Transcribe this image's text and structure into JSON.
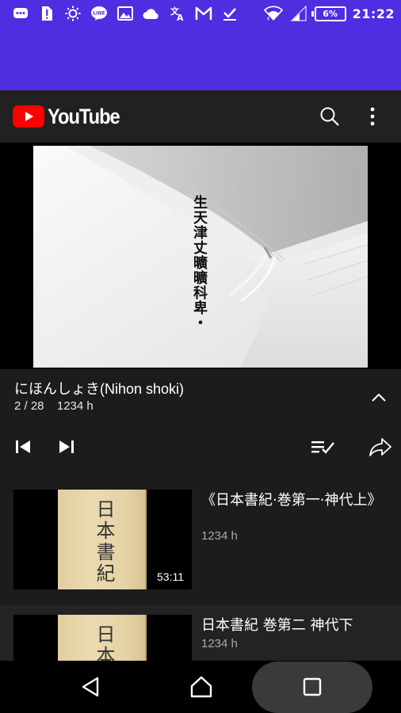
{
  "status_bar": {
    "icons": [
      "chat-icon",
      "sim-alert-icon",
      "brightness-icon",
      "line-app-icon",
      "image-icon",
      "cloud-icon",
      "translate-icon",
      "gmail-icon",
      "task-done-icon"
    ],
    "battery_percent": "6%",
    "time": "21:22"
  },
  "header": {
    "logo_text": "YouTube",
    "icons": [
      "search-icon",
      "more-vert-icon"
    ]
  },
  "player": {
    "overlay_text": "生天津丈曠曠科卑・"
  },
  "now_playing": {
    "title": "にほんしょき(Nihon shoki)",
    "position": "2 / 28",
    "views": "1234 h"
  },
  "controls": [
    "skip-previous-icon",
    "skip-next-icon",
    "playlist-check-icon",
    "share-icon"
  ],
  "playlist": [
    {
      "title": "《日本書紀·巻第一·神代上》",
      "views": "1234 h",
      "duration": "53:11",
      "thumb_text": "日本書紀"
    },
    {
      "title": "日本書紀 巻第二 神代下",
      "views": "1234 h",
      "duration": "",
      "thumb_text": "日本書"
    }
  ],
  "colors": {
    "status_bar": "#4f2de0",
    "youtube_red": "#ff0000",
    "background": "#1c1c1c"
  }
}
